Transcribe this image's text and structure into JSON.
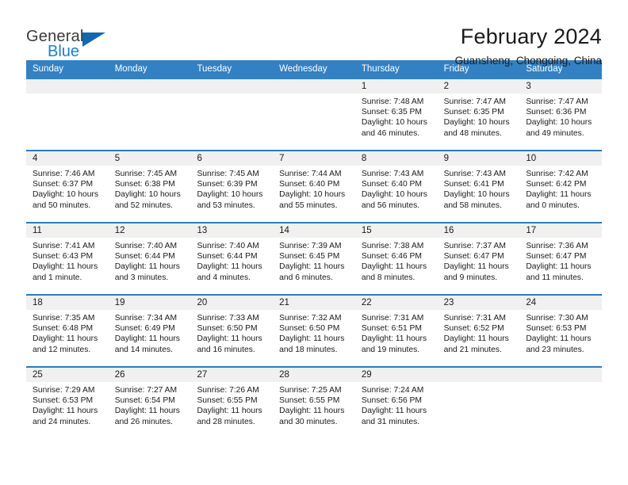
{
  "brand": {
    "name_top": "General",
    "name_bottom": "Blue",
    "triangle_color": "#1567ad",
    "blue_text_color": "#1f7ec2"
  },
  "header": {
    "title": "February 2024",
    "subtitle": "Guansheng, Chongqing, China"
  },
  "theme": {
    "header_row_bg": "#3281c4",
    "row_divider": "#2e7bbd",
    "daynum_band_bg": "#f0f0f0"
  },
  "calendar": {
    "weekday_headers": [
      "Sunday",
      "Monday",
      "Tuesday",
      "Wednesday",
      "Thursday",
      "Friday",
      "Saturday"
    ],
    "weeks": [
      [
        {
          "day": "",
          "sunrise": "",
          "sunset": "",
          "daylight": "",
          "empty": true
        },
        {
          "day": "",
          "sunrise": "",
          "sunset": "",
          "daylight": "",
          "empty": true
        },
        {
          "day": "",
          "sunrise": "",
          "sunset": "",
          "daylight": "",
          "empty": true
        },
        {
          "day": "",
          "sunrise": "",
          "sunset": "",
          "daylight": "",
          "empty": true
        },
        {
          "day": "1",
          "sunrise": "Sunrise: 7:48 AM",
          "sunset": "Sunset: 6:35 PM",
          "daylight": "Daylight: 10 hours and 46 minutes."
        },
        {
          "day": "2",
          "sunrise": "Sunrise: 7:47 AM",
          "sunset": "Sunset: 6:35 PM",
          "daylight": "Daylight: 10 hours and 48 minutes."
        },
        {
          "day": "3",
          "sunrise": "Sunrise: 7:47 AM",
          "sunset": "Sunset: 6:36 PM",
          "daylight": "Daylight: 10 hours and 49 minutes."
        }
      ],
      [
        {
          "day": "4",
          "sunrise": "Sunrise: 7:46 AM",
          "sunset": "Sunset: 6:37 PM",
          "daylight": "Daylight: 10 hours and 50 minutes."
        },
        {
          "day": "5",
          "sunrise": "Sunrise: 7:45 AM",
          "sunset": "Sunset: 6:38 PM",
          "daylight": "Daylight: 10 hours and 52 minutes."
        },
        {
          "day": "6",
          "sunrise": "Sunrise: 7:45 AM",
          "sunset": "Sunset: 6:39 PM",
          "daylight": "Daylight: 10 hours and 53 minutes."
        },
        {
          "day": "7",
          "sunrise": "Sunrise: 7:44 AM",
          "sunset": "Sunset: 6:40 PM",
          "daylight": "Daylight: 10 hours and 55 minutes."
        },
        {
          "day": "8",
          "sunrise": "Sunrise: 7:43 AM",
          "sunset": "Sunset: 6:40 PM",
          "daylight": "Daylight: 10 hours and 56 minutes."
        },
        {
          "day": "9",
          "sunrise": "Sunrise: 7:43 AM",
          "sunset": "Sunset: 6:41 PM",
          "daylight": "Daylight: 10 hours and 58 minutes."
        },
        {
          "day": "10",
          "sunrise": "Sunrise: 7:42 AM",
          "sunset": "Sunset: 6:42 PM",
          "daylight": "Daylight: 11 hours and 0 minutes."
        }
      ],
      [
        {
          "day": "11",
          "sunrise": "Sunrise: 7:41 AM",
          "sunset": "Sunset: 6:43 PM",
          "daylight": "Daylight: 11 hours and 1 minute."
        },
        {
          "day": "12",
          "sunrise": "Sunrise: 7:40 AM",
          "sunset": "Sunset: 6:44 PM",
          "daylight": "Daylight: 11 hours and 3 minutes."
        },
        {
          "day": "13",
          "sunrise": "Sunrise: 7:40 AM",
          "sunset": "Sunset: 6:44 PM",
          "daylight": "Daylight: 11 hours and 4 minutes."
        },
        {
          "day": "14",
          "sunrise": "Sunrise: 7:39 AM",
          "sunset": "Sunset: 6:45 PM",
          "daylight": "Daylight: 11 hours and 6 minutes."
        },
        {
          "day": "15",
          "sunrise": "Sunrise: 7:38 AM",
          "sunset": "Sunset: 6:46 PM",
          "daylight": "Daylight: 11 hours and 8 minutes."
        },
        {
          "day": "16",
          "sunrise": "Sunrise: 7:37 AM",
          "sunset": "Sunset: 6:47 PM",
          "daylight": "Daylight: 11 hours and 9 minutes."
        },
        {
          "day": "17",
          "sunrise": "Sunrise: 7:36 AM",
          "sunset": "Sunset: 6:47 PM",
          "daylight": "Daylight: 11 hours and 11 minutes."
        }
      ],
      [
        {
          "day": "18",
          "sunrise": "Sunrise: 7:35 AM",
          "sunset": "Sunset: 6:48 PM",
          "daylight": "Daylight: 11 hours and 12 minutes."
        },
        {
          "day": "19",
          "sunrise": "Sunrise: 7:34 AM",
          "sunset": "Sunset: 6:49 PM",
          "daylight": "Daylight: 11 hours and 14 minutes."
        },
        {
          "day": "20",
          "sunrise": "Sunrise: 7:33 AM",
          "sunset": "Sunset: 6:50 PM",
          "daylight": "Daylight: 11 hours and 16 minutes."
        },
        {
          "day": "21",
          "sunrise": "Sunrise: 7:32 AM",
          "sunset": "Sunset: 6:50 PM",
          "daylight": "Daylight: 11 hours and 18 minutes."
        },
        {
          "day": "22",
          "sunrise": "Sunrise: 7:31 AM",
          "sunset": "Sunset: 6:51 PM",
          "daylight": "Daylight: 11 hours and 19 minutes."
        },
        {
          "day": "23",
          "sunrise": "Sunrise: 7:31 AM",
          "sunset": "Sunset: 6:52 PM",
          "daylight": "Daylight: 11 hours and 21 minutes."
        },
        {
          "day": "24",
          "sunrise": "Sunrise: 7:30 AM",
          "sunset": "Sunset: 6:53 PM",
          "daylight": "Daylight: 11 hours and 23 minutes."
        }
      ],
      [
        {
          "day": "25",
          "sunrise": "Sunrise: 7:29 AM",
          "sunset": "Sunset: 6:53 PM",
          "daylight": "Daylight: 11 hours and 24 minutes."
        },
        {
          "day": "26",
          "sunrise": "Sunrise: 7:27 AM",
          "sunset": "Sunset: 6:54 PM",
          "daylight": "Daylight: 11 hours and 26 minutes."
        },
        {
          "day": "27",
          "sunrise": "Sunrise: 7:26 AM",
          "sunset": "Sunset: 6:55 PM",
          "daylight": "Daylight: 11 hours and 28 minutes."
        },
        {
          "day": "28",
          "sunrise": "Sunrise: 7:25 AM",
          "sunset": "Sunset: 6:55 PM",
          "daylight": "Daylight: 11 hours and 30 minutes."
        },
        {
          "day": "29",
          "sunrise": "Sunrise: 7:24 AM",
          "sunset": "Sunset: 6:56 PM",
          "daylight": "Daylight: 11 hours and 31 minutes."
        },
        {
          "day": "",
          "sunrise": "",
          "sunset": "",
          "daylight": "",
          "empty": true
        },
        {
          "day": "",
          "sunrise": "",
          "sunset": "",
          "daylight": "",
          "empty": true
        }
      ]
    ]
  }
}
